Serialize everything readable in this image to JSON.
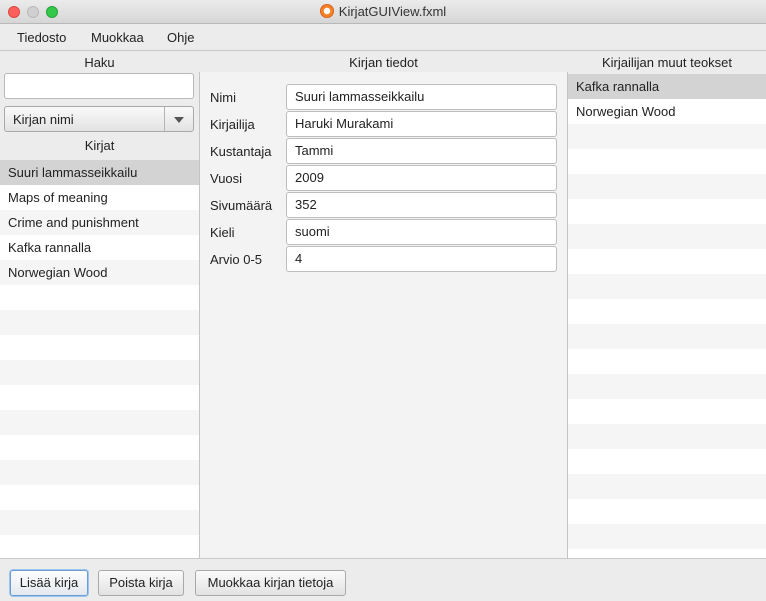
{
  "window": {
    "title": "KirjatGUIView.fxml",
    "app_icon": "app-icon"
  },
  "menu": {
    "items": [
      "Tiedosto",
      "Muokkaa",
      "Ohje"
    ]
  },
  "left_panel": {
    "header": "Haku",
    "search_value": "",
    "combo_selected": "Kirjan nimi",
    "list_header": "Kirjat",
    "books": [
      "Suuri lammasseikkailu",
      "Maps of meaning",
      "Crime and punishment",
      "Kafka rannalla",
      "Norwegian Wood"
    ],
    "selected_index": 0
  },
  "center_panel": {
    "header": "Kirjan tiedot",
    "fields": [
      {
        "label": "Nimi",
        "value": "Suuri lammasseikkailu"
      },
      {
        "label": "Kirjailija",
        "value": "Haruki Murakami"
      },
      {
        "label": "Kustantaja",
        "value": "Tammi"
      },
      {
        "label": "Vuosi",
        "value": "2009"
      },
      {
        "label": "Sivumäärä",
        "value": "352"
      },
      {
        "label": "Kieli",
        "value": "suomi"
      },
      {
        "label": "Arvio 0-5",
        "value": "4"
      }
    ]
  },
  "right_panel": {
    "header": "Kirjailijan muut teokset",
    "works": [
      "Kafka rannalla",
      "Norwegian Wood"
    ],
    "selected_index": 0
  },
  "buttons": {
    "add": "Lisää kirja",
    "remove": "Poista kirja",
    "edit": "Muokkaa kirjan tietoja"
  },
  "colors": {
    "selection": "#d3d3d3",
    "default_button_focus": "#6a9fd6"
  }
}
